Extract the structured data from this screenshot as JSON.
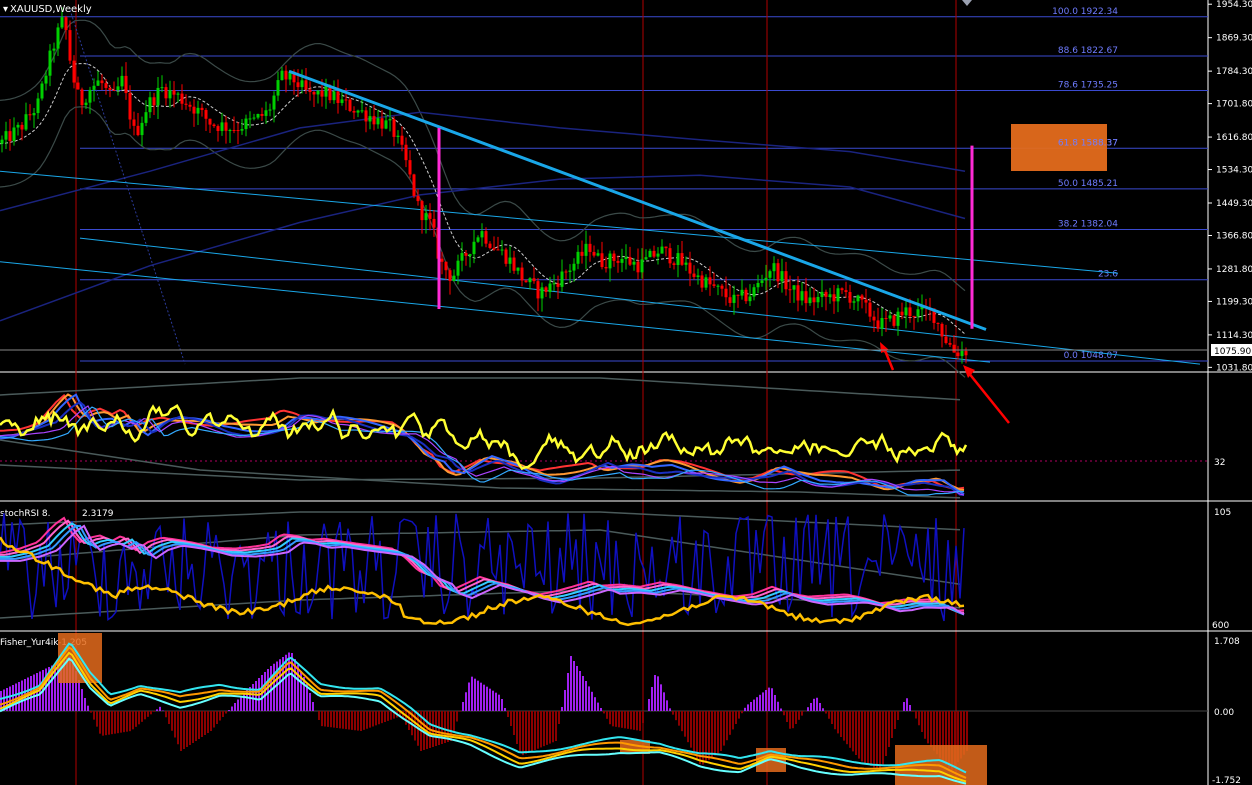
{
  "header": {
    "symbol": "XAUUSD,Weekly"
  },
  "colors": {
    "background": "#000000",
    "grid_vertical": "#b00000",
    "fib_line": "#3a4ad0",
    "fib_text": "#6f7cff",
    "bull_candle": "#00d000",
    "bear_candle": "#ff0000",
    "trendline": "#1aa7e8",
    "magenta": "#ff2bd6",
    "orange_box": "#e46b1c",
    "yellow": "#ffff33",
    "gold": "#ffc000",
    "fisher_pos": "#a020f0",
    "fisher_neg": "#8b0000",
    "cyan": "#33e6f0",
    "orange_line": "#ff9900",
    "band": "#5a6a6a",
    "navy_ma": "#1a237e"
  },
  "chart_data": [
    {
      "type": "candlestick",
      "panel": "main",
      "title": "XAUUSD,Weekly",
      "y_ticks": [
        1954.3,
        1869.3,
        1784.3,
        1701.8,
        1616.8,
        1534.3,
        1449.3,
        1366.8,
        1281.8,
        1199.3,
        1114.3,
        1031.8
      ],
      "last_price": 1075.9,
      "ylim": [
        1020,
        1965
      ],
      "fib_levels": [
        {
          "label": "100.0 1922.34",
          "price": 1922.34
        },
        {
          "label": "88.6 1822.67",
          "price": 1822.67
        },
        {
          "label": "78.6 1735.25",
          "price": 1735.25
        },
        {
          "label": "61.8 1588.37",
          "price": 1588.37
        },
        {
          "label": "50.0 1485.21",
          "price": 1485.21
        },
        {
          "label": "38.2 1382.04",
          "price": 1382.04
        },
        {
          "label": "23.6",
          "price": 1254.5
        },
        {
          "label": "0.0 1048.07",
          "price": 1048.07
        }
      ],
      "close_anchors": [
        [
          0,
          1600
        ],
        [
          20,
          1640
        ],
        [
          38,
          1700
        ],
        [
          48,
          1800
        ],
        [
          56,
          1870
        ],
        [
          64,
          1920
        ],
        [
          72,
          1780
        ],
        [
          80,
          1700
        ],
        [
          90,
          1740
        ],
        [
          100,
          1760
        ],
        [
          112,
          1710
        ],
        [
          122,
          1760
        ],
        [
          135,
          1620
        ],
        [
          148,
          1700
        ],
        [
          162,
          1740
        ],
        [
          178,
          1720
        ],
        [
          195,
          1690
        ],
        [
          212,
          1650
        ],
        [
          235,
          1640
        ],
        [
          255,
          1660
        ],
        [
          268,
          1680
        ],
        [
          282,
          1770
        ],
        [
          295,
          1760
        ],
        [
          310,
          1720
        ],
        [
          325,
          1730
        ],
        [
          345,
          1700
        ],
        [
          370,
          1670
        ],
        [
          392,
          1640
        ],
        [
          405,
          1560
        ],
        [
          418,
          1440
        ],
        [
          432,
          1390
        ],
        [
          440,
          1300
        ],
        [
          452,
          1260
        ],
        [
          466,
          1320
        ],
        [
          480,
          1380
        ],
        [
          494,
          1340
        ],
        [
          508,
          1310
        ],
        [
          522,
          1260
        ],
        [
          540,
          1220
        ],
        [
          556,
          1250
        ],
        [
          572,
          1290
        ],
        [
          590,
          1340
        ],
        [
          600,
          1300
        ],
        [
          620,
          1310
        ],
        [
          640,
          1290
        ],
        [
          660,
          1330
        ],
        [
          680,
          1300
        ],
        [
          698,
          1260
        ],
        [
          716,
          1230
        ],
        [
          734,
          1200
        ],
        [
          752,
          1220
        ],
        [
          772,
          1290
        ],
        [
          790,
          1230
        ],
        [
          808,
          1200
        ],
        [
          826,
          1210
        ],
        [
          846,
          1220
        ],
        [
          862,
          1190
        ],
        [
          880,
          1140
        ],
        [
          892,
          1150
        ],
        [
          905,
          1175
        ],
        [
          920,
          1170
        ],
        [
          932,
          1175
        ],
        [
          944,
          1110
        ],
        [
          955,
          1070
        ],
        [
          967,
          1076
        ]
      ],
      "trendline_upper": [
        [
          289,
          1784
        ],
        [
          986,
          1128
        ]
      ],
      "channel_lower": [
        [
          0,
          1300
        ],
        [
          990,
          1045
        ]
      ],
      "channel_mid": [
        [
          0,
          1530
        ],
        [
          1118,
          1271
        ]
      ],
      "swing_low_line": [
        [
          80,
          1360
        ],
        [
          1200,
          1040
        ]
      ],
      "vertical_lines_x": [
        76,
        643,
        767,
        956
      ],
      "target_box": {
        "label": "61.8 1588.37"
      }
    },
    {
      "type": "line",
      "panel": "rsi",
      "y_ticks": [
        32
      ]
    },
    {
      "type": "line",
      "panel": "stochrsi",
      "title": "stochRSI 8.",
      "title_value": "2.3179",
      "y_ticks": [
        105,
        600
      ]
    },
    {
      "type": "bar",
      "panel": "fisher",
      "title": "Fisher_Yur4ik",
      "title_value": "-1.205",
      "y_ticks": [
        1.708,
        0.0,
        -1.752
      ]
    }
  ]
}
